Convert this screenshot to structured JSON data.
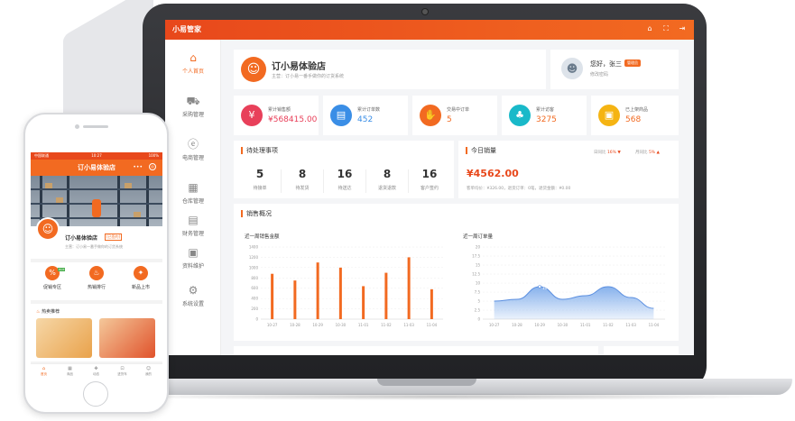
{
  "desktop": {
    "brand": "小易管家",
    "top_icons": [
      "home-icon",
      "expand-icon",
      "logout-icon"
    ],
    "sidebar": [
      {
        "label": "个人首页",
        "icon": "home-icon",
        "active": true
      },
      {
        "label": "采购管理",
        "icon": "truck-icon",
        "active": false
      },
      {
        "label": "电商管理",
        "icon": "ecommerce-icon",
        "active": false
      },
      {
        "label": "仓库管理",
        "icon": "warehouse-icon",
        "active": false
      },
      {
        "label": "财务管理",
        "icon": "finance-icon",
        "active": false
      },
      {
        "label": "资料维护",
        "icon": "document-icon",
        "active": false
      },
      {
        "label": "系统设置",
        "icon": "gear-icon",
        "active": false
      }
    ],
    "store": {
      "name": "订小易体验店",
      "sub": "主营：订小易一番手做你的订货系统"
    },
    "user": {
      "greeting": "您好，张三",
      "badge": "管理员",
      "password_link": "修改密码"
    },
    "stats": [
      {
        "label": "累计销售额",
        "value": "¥568415.00",
        "color": "#e8405a"
      },
      {
        "label": "累计订单数",
        "value": "452",
        "color": "#3a8ee6"
      },
      {
        "label": "交易中订单",
        "value": "5",
        "color": "#f26a21"
      },
      {
        "label": "累计访客",
        "value": "3275",
        "color": "#19b9c9"
      },
      {
        "label": "已上架商品",
        "value": "568",
        "color": "#f5b413"
      }
    ],
    "todo": {
      "title": "待处理事项",
      "items": [
        {
          "num": "5",
          "label": "待接单"
        },
        {
          "num": "8",
          "label": "待发货"
        },
        {
          "num": "16",
          "label": "待送达"
        },
        {
          "num": "8",
          "label": "退货退款"
        },
        {
          "num": "16",
          "label": "客户签约"
        }
      ]
    },
    "today": {
      "title": "今日销量",
      "day_ratio_label": "日同比",
      "day_ratio": "16%",
      "month_ratio_label": "月同比",
      "month_ratio": "5%",
      "amount": "¥4562.00",
      "meta": "客单均价：¥326.00，退货订单：0笔，退货金额：¥0.00"
    },
    "sales_title": "销售概况",
    "chart_data": [
      {
        "type": "bar",
        "title": "近一周销售金额",
        "categories": [
          "10-27",
          "10-28",
          "10-29",
          "10-30",
          "11-01",
          "11-02",
          "11-03",
          "11-04"
        ],
        "values": [
          880,
          750,
          1100,
          1000,
          640,
          900,
          1200,
          580
        ],
        "ylim": [
          0,
          1400
        ],
        "yticks": [
          0,
          200,
          400,
          600,
          800,
          1000,
          1200,
          1400
        ],
        "color": "#f26a21",
        "grid": true
      },
      {
        "type": "area",
        "title": "近一周订单量",
        "categories": [
          "10-27",
          "10-28",
          "10-29",
          "10-30",
          "11-01",
          "11-02",
          "11-03",
          "11-04"
        ],
        "values": [
          5,
          5.5,
          9,
          5.5,
          6.5,
          9,
          6,
          3
        ],
        "ylim": [
          0,
          20
        ],
        "yticks": [
          0,
          2.5,
          5,
          7.5,
          10,
          12.5,
          15,
          17.5,
          20
        ],
        "tooltip": "10-29，9笔",
        "color": "#7aa9ea",
        "grid": true
      }
    ]
  },
  "phone": {
    "status_left": "中国联通",
    "time": "10:27",
    "status_right": "100%",
    "title": "订小易体验店",
    "more": "•••",
    "close": "◎",
    "store_name": "订小易体验店",
    "store_tag": "[已签约]",
    "store_sub": "主营：订小易一番手做你的订货系统",
    "menu": [
      {
        "label": "促销专区",
        "icon": "sale-icon"
      },
      {
        "label": "热销排行",
        "icon": "fire-icon"
      },
      {
        "label": "新品上市",
        "icon": "new-product-icon"
      }
    ],
    "hot_badge": "HOT",
    "recommend_title": "热卖推荐",
    "tabs": [
      {
        "label": "首页",
        "icon": "home-icon",
        "active": true
      },
      {
        "label": "商品",
        "icon": "grid-icon",
        "active": false
      },
      {
        "label": "动态",
        "icon": "compass-icon",
        "active": false
      },
      {
        "label": "进货车",
        "icon": "cart-icon",
        "active": false
      },
      {
        "label": "我的",
        "icon": "user-icon",
        "active": false
      }
    ]
  }
}
